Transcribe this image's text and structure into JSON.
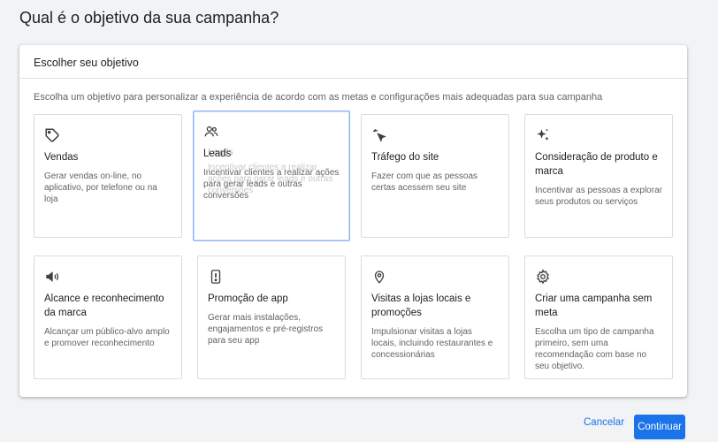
{
  "page": {
    "title": "Qual é o objetivo da sua campanha?"
  },
  "panel": {
    "header": "Escolher seu objetivo",
    "description": "Escolha um objetivo para personalizar a experiência de acordo com as metas e configurações mais adequadas para sua campanha"
  },
  "cards": [
    {
      "icon": "tag-icon",
      "title": "Vendas",
      "description": "Gerar vendas on-line, no aplicativo, por telefone ou na loja"
    },
    {
      "icon": "people-icon",
      "title": "Leads",
      "description": "Incentivar clientes a realizar ações para gerar leads e outras conversões",
      "ghost_title": "Leads",
      "ghost_description": "Incentivar clientes a realizar ações para gerar leads e outras conversões"
    },
    {
      "icon": "cursor-click-icon",
      "title": "Tráfego do site",
      "description": "Fazer com que as pessoas certas acessem seu site"
    },
    {
      "icon": "sparkle-icon",
      "title": "Consideração de produto e marca",
      "description": "Incentivar as pessoas a explorar seus produtos ou serviços"
    },
    {
      "icon": "megaphone-icon",
      "title": "Alcance e reconhecimento da marca",
      "description": "Alcançar um público-alvo amplo e promover reconhecimento"
    },
    {
      "icon": "phone-icon",
      "title": "Promoção de app",
      "description": "Gerar mais instalações, engajamentos e pré-registros para seu app"
    },
    {
      "icon": "location-pin-icon",
      "title": "Visitas a lojas locais e promoções",
      "description": "Impulsionar visitas a lojas locais, incluindo restaurantes e concessionárias"
    },
    {
      "icon": "gear-icon",
      "title": "Criar uma campanha sem meta",
      "description": "Escolha um tipo de campanha primeiro, sem uma recomendação com base no seu objetivo."
    }
  ],
  "actions": {
    "cancel_label": "Cancelar",
    "continue_label": "Continuar"
  },
  "colors": {
    "accent": "#1a73e8",
    "hover_border": "#8ab4f8"
  }
}
